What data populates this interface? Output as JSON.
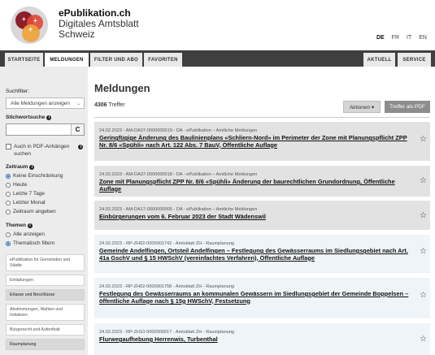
{
  "brand": {
    "line1": "ePublikation.ch",
    "line2": "Digitales Amtsblatt",
    "line3": "Schweiz",
    "logo_colors": [
      "#f1a33a",
      "#e1483a",
      "#8c1f2a",
      "#aaaaaa",
      "#d8d8d8"
    ]
  },
  "languages": [
    "DE",
    "FR",
    "IT",
    "EN"
  ],
  "active_language": "DE",
  "nav": {
    "left": [
      "STARTSEITE",
      "MELDUNGEN",
      "FILTER UND ABO",
      "FAVORITEN"
    ],
    "right": [
      "AKTUELL",
      "SERVICE"
    ],
    "active": "MELDUNGEN"
  },
  "sidebar": {
    "suchfilter_label": "Suchfilter:",
    "suchfilter_value": "Alle Meldungen anzeigen",
    "stichwort_label": "Stichwortsuche",
    "stichwort_value": "",
    "search_button": "C",
    "pdf_check_label_1": "Auch in PDF-Anhängen",
    "pdf_check_label_2": "suchen",
    "zeitraum_label": "Zeitraum",
    "zeitraum_options": [
      "Keine Einschränkung",
      "Heute",
      "Letzte 7 Tage",
      "Letzter Monat",
      "Zeitraum angeben"
    ],
    "zeitraum_selected": 0,
    "themen_label": "Themen",
    "themen_options": [
      "Alle anzeigen",
      "Thematisch filtern"
    ],
    "themen_selected": 1,
    "themes": [
      "ePublikation für Gemeinden und Städte",
      "Einladungen",
      "Erlasse und Beschlüsse",
      "Abstimmungen, Wahlen und Initiativen",
      "Bürgerrecht und Aufenthalt",
      "Raumplanung"
    ]
  },
  "main": {
    "title": "Meldungen",
    "count_number": "4306",
    "count_label": "Treffer",
    "actions_button": "Aktionen ▾",
    "pdf_button": "Treffer als PDF",
    "items": [
      {
        "meta": "24.02.2023 - AM-DA37-0000000019 - DA - ePublikation – Amtliche Meldungen",
        "headline": "Geringfügige Änderung des Baulinienplans «Schliern-Nord» im Perimeter der Zone mit Planungspflicht ZPP Nr. 8/6 «Spühli» nach Art. 122 Abs. 7 BauV, Öffentliche Auflage",
        "style": "grey"
      },
      {
        "meta": "24.02.2023 - AM-DA37-0000000018 - DA - ePublikation – Amtliche Meldungen",
        "headline": "Zone mit Planungspflicht ZPP Nr. 8/6 «Spühli» Änderung der baurechtlichen Grundordnung, Öffentliche Auflage",
        "style": "grey"
      },
      {
        "meta": "24.02.2023 - AM-DA17-0000000005 - DA - ePublikation – Amtliche Meldungen",
        "headline": "Einbürgerungen vom 6. Februar 2023 der Stadt Wädenswil",
        "style": "grey"
      },
      {
        "meta": "24.02.2023 - RP-ZH02-0000001742 - Amtsblatt ZH - Raumplanung",
        "headline": "Gemeinde Andelfingen, Ortsteil Andelfingen – Festlegung des Gewässerraums im Siedlungsgebiet nach Art. 41a GschV und § 15 HWSchV (vereinfachtes Verfahren), Öffentliche Auflage",
        "style": "light"
      },
      {
        "meta": "24.02.2023 - RP-ZH02-0000001758 - Amtsblatt ZH - Raumplanung",
        "headline": "Festlegung des Gewässerraums an kommunalen Gewässern im Siedlungsgebiet der Gemeinde Boppelsen – öffentliche Auflage nach § 15g HWSchV, Festsetzung",
        "style": "light"
      },
      {
        "meta": "24.02.2023 - RP-ZH10-0000000017 - Amtsblatt ZH - Raumplanung",
        "headline": "Flurwegaufhebung Herrenwis, Turbenthal",
        "style": "light"
      }
    ]
  }
}
